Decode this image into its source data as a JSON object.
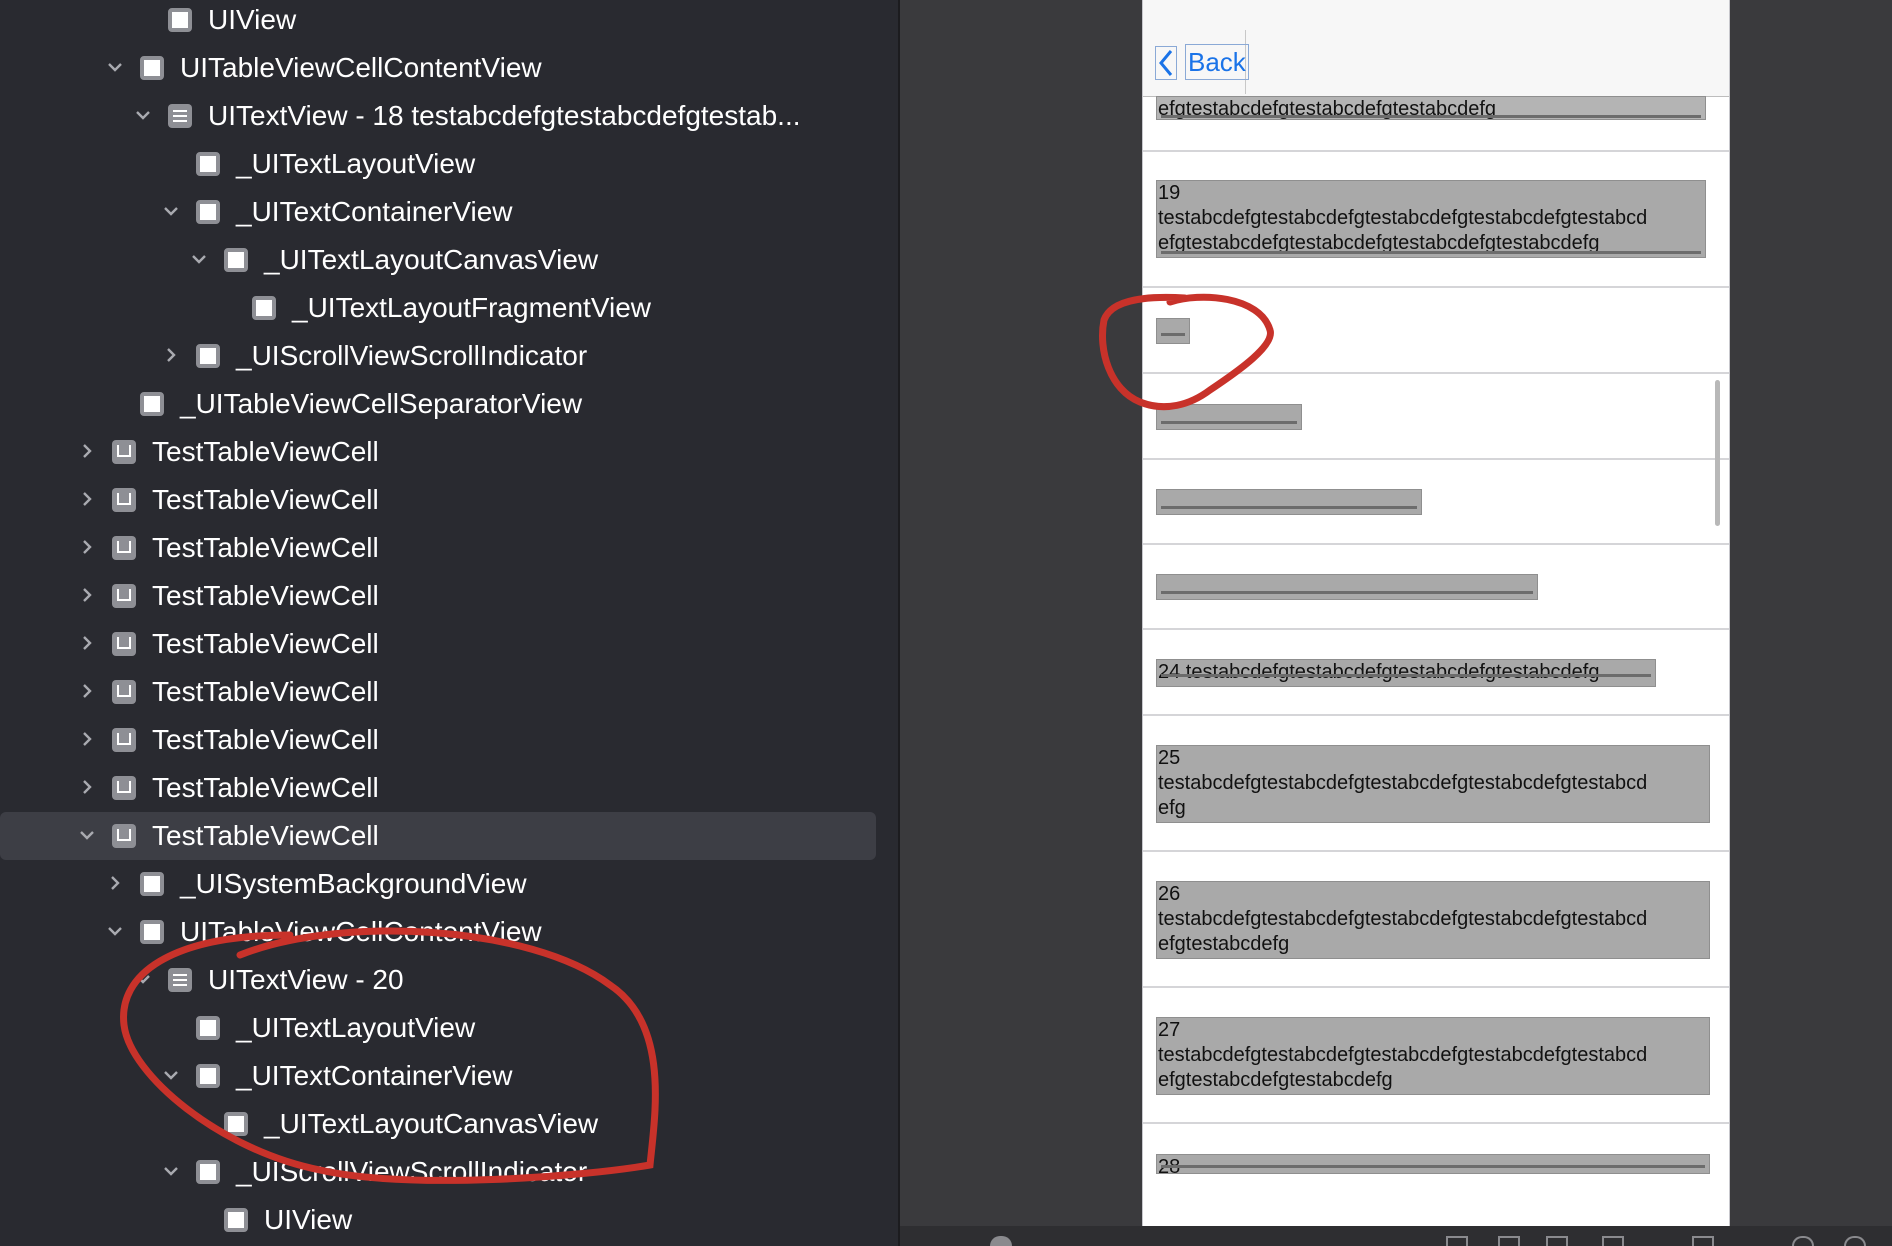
{
  "hierarchy": [
    {
      "label": "UIView",
      "depth": 6,
      "icon": "view",
      "chevron": "none"
    },
    {
      "label": "UITableViewCellContentView",
      "depth": 5,
      "icon": "view",
      "chevron": "down"
    },
    {
      "label": "UITextView - 18 testabcdefgtestabcdefgtestab...",
      "depth": 6,
      "icon": "text",
      "chevron": "down"
    },
    {
      "label": "_UITextLayoutView",
      "depth": 7,
      "icon": "view",
      "chevron": "none"
    },
    {
      "label": "_UITextContainerView",
      "depth": 7,
      "icon": "view",
      "chevron": "down"
    },
    {
      "label": "_UITextLayoutCanvasView",
      "depth": 8,
      "icon": "view",
      "chevron": "down"
    },
    {
      "label": "_UITextLayoutFragmentView",
      "depth": 9,
      "icon": "view",
      "chevron": "none"
    },
    {
      "label": "_UIScrollViewScrollIndicator",
      "depth": 7,
      "icon": "view",
      "chevron": "right"
    },
    {
      "label": "_UITableViewCellSeparatorView",
      "depth": 5,
      "icon": "view",
      "chevron": "none"
    },
    {
      "label": "TestTableViewCell",
      "depth": 4,
      "icon": "cell",
      "chevron": "right"
    },
    {
      "label": "TestTableViewCell",
      "depth": 4,
      "icon": "cell",
      "chevron": "right"
    },
    {
      "label": "TestTableViewCell",
      "depth": 4,
      "icon": "cell",
      "chevron": "right"
    },
    {
      "label": "TestTableViewCell",
      "depth": 4,
      "icon": "cell",
      "chevron": "right"
    },
    {
      "label": "TestTableViewCell",
      "depth": 4,
      "icon": "cell",
      "chevron": "right"
    },
    {
      "label": "TestTableViewCell",
      "depth": 4,
      "icon": "cell",
      "chevron": "right"
    },
    {
      "label": "TestTableViewCell",
      "depth": 4,
      "icon": "cell",
      "chevron": "right"
    },
    {
      "label": "TestTableViewCell",
      "depth": 4,
      "icon": "cell",
      "chevron": "right"
    },
    {
      "label": "TestTableViewCell",
      "depth": 4,
      "icon": "cell",
      "chevron": "down",
      "selected": true
    },
    {
      "label": "_UISystemBackgroundView",
      "depth": 5,
      "icon": "view",
      "chevron": "right"
    },
    {
      "label": "UITableViewCellContentView",
      "depth": 5,
      "icon": "view",
      "chevron": "down"
    },
    {
      "label": "UITextView - 20",
      "depth": 6,
      "icon": "text",
      "chevron": "down"
    },
    {
      "label": "_UITextLayoutView",
      "depth": 7,
      "icon": "view",
      "chevron": "none"
    },
    {
      "label": "_UITextContainerView",
      "depth": 7,
      "icon": "view",
      "chevron": "down"
    },
    {
      "label": "_UITextLayoutCanvasView",
      "depth": 8,
      "icon": "view",
      "chevron": "none"
    },
    {
      "label": "_UIScrollViewScrollIndicator",
      "depth": 7,
      "icon": "view",
      "chevron": "down"
    },
    {
      "label": "UIView",
      "depth": 8,
      "icon": "view",
      "chevron": "none"
    }
  ],
  "phone": {
    "back_label": "Back",
    "cells": [
      {
        "lines": [
          "efgtestabcdefgtestabcdefgtestabcdefg"
        ]
      },
      {
        "lines": [
          "19",
          "testabcdefgtestabcdefgtestabcdefgtestabcdefgtestabcd",
          "efgtestabcdefgtestabcdefgtestabcdefgtestabcdefg"
        ]
      },
      {
        "lines": []
      },
      {
        "lines": []
      },
      {
        "lines": []
      },
      {
        "lines": []
      },
      {
        "lines": [
          "24 testabcdefgtestabcdefgtestabcdefgtestabcdefg"
        ]
      },
      {
        "lines": [
          "25",
          "testabcdefgtestabcdefgtestabcdefgtestabcdefgtestabcd",
          "efg"
        ]
      },
      {
        "lines": [
          "26",
          "testabcdefgtestabcdefgtestabcdefgtestabcdefgtestabcd",
          "efgtestabcdefg"
        ]
      },
      {
        "lines": [
          "27",
          "testabcdefgtestabcdefgtestabcdefgtestabcdefgtestabcd",
          "efgtestabcdefgtestabcdefg"
        ]
      },
      {
        "lines": [
          "28"
        ]
      }
    ]
  },
  "colors": {
    "background": "#292a30",
    "selection": "#3d3e45",
    "annotation": "#c8322a",
    "text_view_fill": "#a9a9a9"
  }
}
